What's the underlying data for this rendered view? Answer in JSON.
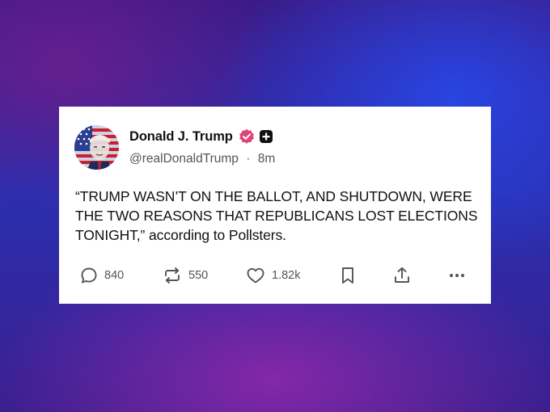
{
  "post": {
    "display_name": "Donald J. Trump",
    "handle": "@realDonaldTrump",
    "separator": "·",
    "time": "8m",
    "text": "“TRUMP WASN’T ON THE BALLOT, AND SHUTDOWN, WERE THE TWO REASONS THAT REPUBLICANS LOST ELECTIONS TONIGHT,” according to Pollsters.",
    "avatar": "avatar-flag-portrait",
    "badges": [
      "verified-badge-icon",
      "plus-badge-icon"
    ]
  },
  "actions": {
    "replies": "840",
    "reposts": "550",
    "likes": "1.82k",
    "icons": [
      "reply-icon",
      "repost-icon",
      "like-icon",
      "bookmark-icon",
      "share-icon",
      "more-icon"
    ]
  },
  "colors": {
    "verified": "#e0427a",
    "text": "#111111",
    "muted": "#555555",
    "card": "#ffffff"
  }
}
